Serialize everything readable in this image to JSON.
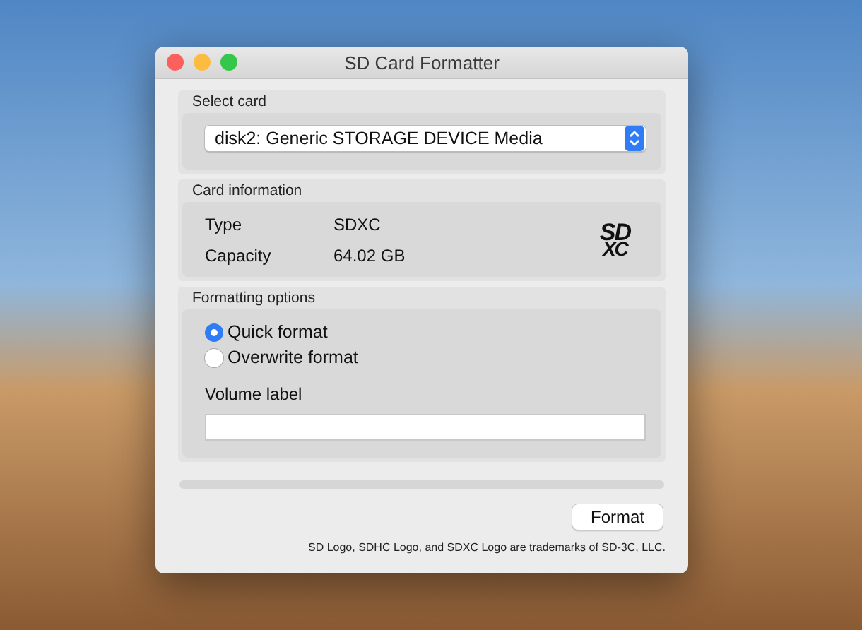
{
  "window": {
    "title": "SD Card Formatter"
  },
  "select_card": {
    "heading": "Select card",
    "value": "disk2: Generic STORAGE DEVICE Media"
  },
  "card_information": {
    "heading": "Card information",
    "fields": [
      {
        "label": "Type",
        "value": "SDXC"
      },
      {
        "label": "Capacity",
        "value": "64.02 GB"
      }
    ],
    "logo": {
      "top": "SD",
      "bottom": "XC"
    }
  },
  "formatting_options": {
    "heading": "Formatting options",
    "options": [
      {
        "label": "Quick format",
        "selected": true
      },
      {
        "label": "Overwrite format",
        "selected": false
      }
    ],
    "volume_label": {
      "label": "Volume label"
    }
  },
  "progress": {
    "level": 0
  },
  "buttons": [
    "Format"
  ],
  "footer": "SD Logo, SDHC Logo, and SDXC Logo are trademarks of SD-3C, LLC."
}
